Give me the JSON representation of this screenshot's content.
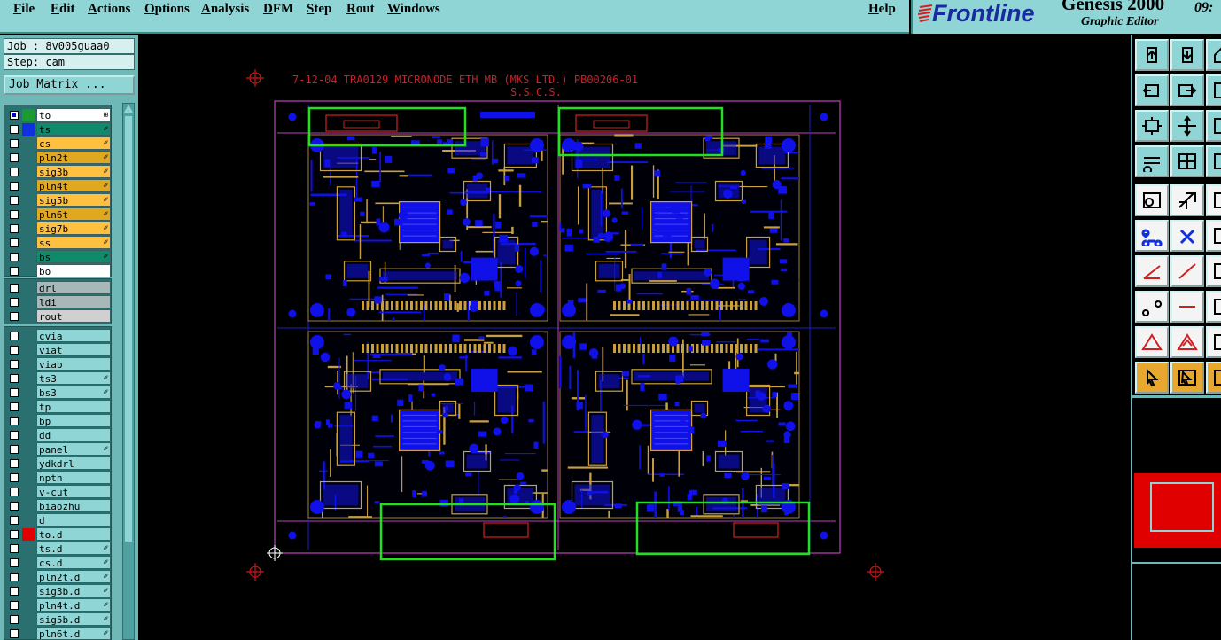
{
  "menu": [
    "File",
    "Edit",
    "Actions",
    "Options",
    "Analysis",
    "DFM",
    "Step",
    "Rout",
    "Windows"
  ],
  "help": "Help",
  "brand": {
    "logo": "Frontline",
    "product": "Genesis 2000",
    "subtitle": "Graphic Editor",
    "time": "09:"
  },
  "job": {
    "job_line": "Job : 8v005guaa0",
    "step_line": "Step: cam",
    "matrix_button": "Job Matrix ..."
  },
  "layers_board": [
    {
      "name": "to",
      "color": "#ffffff",
      "swatch": "#1a9a30",
      "checked": true,
      "mark": "⊞"
    },
    {
      "name": "ts",
      "color": "#0f8a6a",
      "swatch": "#1030e0",
      "checked": false,
      "mark": "✐"
    },
    {
      "name": "cs",
      "color": "#ffc040",
      "swatch": "",
      "checked": false,
      "mark": "✐"
    },
    {
      "name": "pln2t",
      "color": "#e0a820",
      "swatch": "",
      "checked": false,
      "mark": "✐"
    },
    {
      "name": "sig3b",
      "color": "#ffc040",
      "swatch": "",
      "checked": false,
      "mark": "✐"
    },
    {
      "name": "pln4t",
      "color": "#e0a820",
      "swatch": "",
      "checked": false,
      "mark": "✐"
    },
    {
      "name": "sig5b",
      "color": "#ffc040",
      "swatch": "",
      "checked": false,
      "mark": "✐"
    },
    {
      "name": "pln6t",
      "color": "#e0a820",
      "swatch": "",
      "checked": false,
      "mark": "✐"
    },
    {
      "name": "sig7b",
      "color": "#ffc040",
      "swatch": "",
      "checked": false,
      "mark": "✐"
    },
    {
      "name": "ss",
      "color": "#ffc040",
      "swatch": "",
      "checked": false,
      "mark": "✐"
    },
    {
      "name": "bs",
      "color": "#0f8a6a",
      "swatch": "",
      "checked": false,
      "mark": "✐"
    },
    {
      "name": "bo",
      "color": "#ffffff",
      "swatch": "",
      "checked": false,
      "mark": ""
    }
  ],
  "layers_drill": [
    {
      "name": "drl",
      "color": "#a8b8b8"
    },
    {
      "name": "ldi",
      "color": "#a8b8b8"
    },
    {
      "name": "rout",
      "color": "#d0d0d0"
    }
  ],
  "layers_misc": [
    {
      "name": "cvia",
      "mark": "",
      "swatch": ""
    },
    {
      "name": "viat",
      "mark": "",
      "swatch": ""
    },
    {
      "name": "viab",
      "mark": "",
      "swatch": ""
    },
    {
      "name": "ts3",
      "mark": "✐",
      "swatch": ""
    },
    {
      "name": "bs3",
      "mark": "✐",
      "swatch": ""
    },
    {
      "name": "tp",
      "mark": "",
      "swatch": ""
    },
    {
      "name": "bp",
      "mark": "",
      "swatch": ""
    },
    {
      "name": "dd",
      "mark": "",
      "swatch": ""
    },
    {
      "name": "panel",
      "mark": "✐",
      "swatch": ""
    },
    {
      "name": "ydkdrl",
      "mark": "",
      "swatch": ""
    },
    {
      "name": "npth",
      "mark": "",
      "swatch": ""
    },
    {
      "name": "v-cut",
      "mark": "",
      "swatch": ""
    },
    {
      "name": "biaozhu",
      "mark": "",
      "swatch": ""
    },
    {
      "name": "d",
      "mark": "",
      "swatch": ""
    },
    {
      "name": "to.d",
      "mark": "",
      "swatch": "#e00000"
    },
    {
      "name": "ts.d",
      "mark": "✐",
      "swatch": ""
    },
    {
      "name": "cs.d",
      "mark": "✐",
      "swatch": ""
    },
    {
      "name": "pln2t.d",
      "mark": "✐",
      "swatch": ""
    },
    {
      "name": "sig3b.d",
      "mark": "✐",
      "swatch": ""
    },
    {
      "name": "pln4t.d",
      "mark": "✐",
      "swatch": ""
    },
    {
      "name": "sig5b.d",
      "mark": "✐",
      "swatch": ""
    },
    {
      "name": "pln6t.d",
      "mark": "✐",
      "swatch": ""
    }
  ],
  "misc_layer_color": "#8fd5d5",
  "canvas": {
    "title_text": "7-12-04 TRA0129 MICRONODE ETH MB    (MKS LTD.)  PB00206-01",
    "sub_text": "S.S.C.S."
  },
  "colors": {
    "pcb_blue": "#1010e8",
    "pcb_gold": "#c8a040",
    "highlight": "#20e020",
    "outline": "#c040c0",
    "target": "#c81818"
  },
  "tools": [
    "zoom-in-icon",
    "zoom-out-icon",
    "home-icon",
    "pan-left-icon",
    "pan-right-icon",
    "more-icon",
    "fit-icon",
    "center-icon",
    "more-icon",
    "filter-icon",
    "grid-icon",
    "more-icon",
    "select-icon",
    "edit-shape-icon",
    "more-icon",
    "net-icon",
    "cross-icon",
    "more-icon",
    "line-icon",
    "draw-line-icon",
    "more-icon",
    "points-icon",
    "measure-icon",
    "more-icon",
    "triangle-icon",
    "arrow-triangle-icon",
    "more-icon",
    "cursor-icon",
    "cursor-box-icon",
    "more-icon"
  ]
}
